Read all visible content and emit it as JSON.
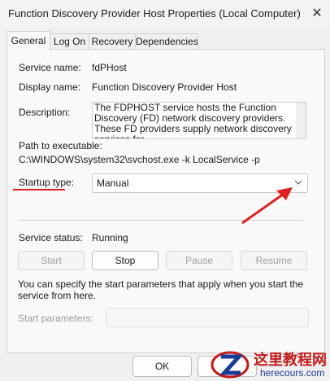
{
  "window": {
    "title": "Function Discovery Provider Host Properties (Local Computer)",
    "close_glyph": "✕"
  },
  "tabs": [
    {
      "label": "General",
      "active": true
    },
    {
      "label": "Log On"
    },
    {
      "label": "Recovery"
    },
    {
      "label": "Dependencies"
    }
  ],
  "general": {
    "service_name_label": "Service name:",
    "service_name_value": "fdPHost",
    "display_name_label": "Display name:",
    "display_name_value": "Function Discovery Provider Host",
    "description_label": "Description:",
    "description_value": "The FDPHOST service hosts the Function Discovery (FD) network discovery providers. These FD providers supply network discovery services for",
    "path_label": "Path to executable:",
    "path_value": "C:\\WINDOWS\\system32\\svchost.exe -k LocalService -p",
    "startup_type_label": "Startup type:",
    "startup_type_value": "Manual",
    "service_status_label": "Service status:",
    "service_status_value": "Running",
    "buttons": {
      "start": "Start",
      "stop": "Stop",
      "pause": "Pause",
      "resume": "Resume"
    },
    "info_text": "You can specify the start parameters that apply when you start the service from here.",
    "start_params_label": "Start parameters:"
  },
  "footer": {
    "ok": "OK",
    "cancel": ""
  },
  "annotation": {
    "color": "#e02020"
  },
  "watermark": {
    "cn": "这里教程网",
    "en": "herecours.com"
  }
}
